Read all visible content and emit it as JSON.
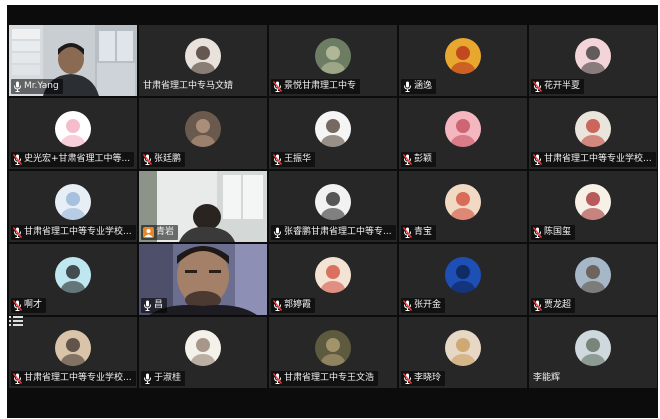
{
  "participants": [
    {
      "name": "Mr.Yang",
      "mic": "on",
      "kind": "video-room",
      "active": true
    },
    {
      "name": "甘肃省理工中专马文婧",
      "mic": "none",
      "kind": "avatar",
      "color": "#e9e2dc",
      "accent": "#3a2a22"
    },
    {
      "name": "景悦甘肃理工中专",
      "mic": "muted",
      "kind": "avatar",
      "color": "#6c7d63",
      "accent": "#c8c9a8"
    },
    {
      "name": "涵逸",
      "mic": "on",
      "kind": "avatar",
      "color": "#e8a72e",
      "accent": "#b4281c"
    },
    {
      "name": "花开半夏",
      "mic": "muted",
      "kind": "avatar",
      "color": "#f3d4d8",
      "accent": "#333333"
    },
    {
      "name": "史光宏+甘肃省理工中等...",
      "mic": "muted",
      "kind": "avatar",
      "color": "#ffffff",
      "accent": "#f2a7b9"
    },
    {
      "name": "张廷鹏",
      "mic": "muted",
      "kind": "avatar",
      "color": "#6a5a4e",
      "accent": "#c2a088"
    },
    {
      "name": "王振华",
      "mic": "muted",
      "kind": "avatar",
      "color": "#f5f5f5",
      "accent": "#4b3a30"
    },
    {
      "name": "彭颖",
      "mic": "muted",
      "kind": "avatar",
      "color": "#f4b7c0",
      "accent": "#c24a5a"
    },
    {
      "name": "甘肃省理工中等专业学校...",
      "mic": "muted",
      "kind": "avatar",
      "color": "#e9e4dc",
      "accent": "#c23c2f"
    },
    {
      "name": "甘肃省理工中等专业学校...",
      "mic": "muted",
      "kind": "avatar",
      "color": "#e8eef5",
      "accent": "#8fb1d6"
    },
    {
      "name": "青岩",
      "mic": "cam",
      "kind": "video-person"
    },
    {
      "name": "张睿鹏甘肃省理工中等专...",
      "mic": "on",
      "kind": "avatar",
      "color": "#f2f2f2",
      "accent": "#222222"
    },
    {
      "name": "青宝",
      "mic": "muted",
      "kind": "avatar",
      "color": "#f2d9c4",
      "accent": "#d04535"
    },
    {
      "name": "陈国玺",
      "mic": "muted",
      "kind": "avatar",
      "color": "#f7f0e6",
      "accent": "#a02a2a"
    },
    {
      "name": "啊才",
      "mic": "muted",
      "kind": "avatar",
      "color": "#bfe7ef",
      "accent": "#1a1a1a"
    },
    {
      "name": "昌",
      "mic": "on",
      "kind": "video-face"
    },
    {
      "name": "郭婷霞",
      "mic": "muted",
      "kind": "avatar",
      "color": "#f3e3d4",
      "accent": "#d24a3a"
    },
    {
      "name": "张开金",
      "mic": "muted",
      "kind": "avatar",
      "color": "#1d4fb5",
      "accent": "#0d1f4a"
    },
    {
      "name": "贾龙超",
      "mic": "muted",
      "kind": "avatar",
      "color": "#a6b8c8",
      "accent": "#5a4a3a"
    },
    {
      "name": "甘肃省理工中等专业学校...",
      "mic": "muted",
      "kind": "avatar",
      "color": "#d9c3a9",
      "accent": "#3a2f2a"
    },
    {
      "name": "于淑桂",
      "mic": "on",
      "kind": "avatar",
      "color": "#f4f0ea",
      "accent": "#8c7a6a"
    },
    {
      "name": "甘肃省理工中专王文浩",
      "mic": "muted",
      "kind": "avatar",
      "color": "#5e5a40",
      "accent": "#b8a878"
    },
    {
      "name": "李晓玲",
      "mic": "muted",
      "kind": "avatar",
      "color": "#e6d8c4",
      "accent": "#c79a5a"
    },
    {
      "name": "李能辉",
      "mic": "none",
      "kind": "avatar",
      "color": "#cfd8dc",
      "accent": "#5a6a5a"
    }
  ]
}
